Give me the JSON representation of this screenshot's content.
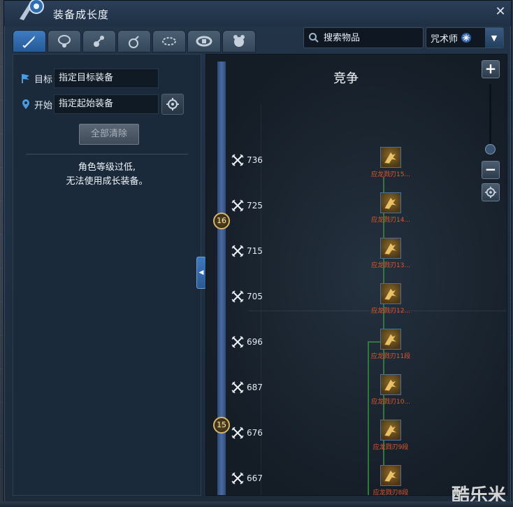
{
  "window": {
    "title": "装备成长度"
  },
  "tabs": [
    {
      "icon": "sword-icon"
    },
    {
      "icon": "necklace-icon"
    },
    {
      "icon": "earring-icon"
    },
    {
      "icon": "ring-icon"
    },
    {
      "icon": "bracelet-icon"
    },
    {
      "icon": "belt-icon"
    },
    {
      "icon": "soul-icon"
    }
  ],
  "search": {
    "placeholder": "搜索物品"
  },
  "class_select": {
    "value": "咒术师"
  },
  "left_panel": {
    "target_label": "目标",
    "target_value": "指定目标装备",
    "start_label": "开始",
    "start_value": "指定起始装备",
    "clear_label": "全部清除",
    "message_line1": "角色等级过低,",
    "message_line2": "无法使用成长装备。"
  },
  "graph": {
    "title": "竞争",
    "level_badges": [
      "16",
      "15"
    ],
    "ticks": [
      "736",
      "725",
      "715",
      "705",
      "696",
      "687",
      "676",
      "667"
    ],
    "nodes": [
      "应龙戮刃15...",
      "应龙戮刃14...",
      "应龙戮刃13...",
      "应龙戮刃12...",
      "应龙戮刃11段",
      "应龙戮刃10...",
      "应龙戮刃9段",
      "应龙戮刃8段"
    ]
  },
  "watermark": "酷乐米",
  "colors": {
    "accent": "#2f6db1",
    "item_name": "#e0582a",
    "connector": "#2f7a3a"
  }
}
